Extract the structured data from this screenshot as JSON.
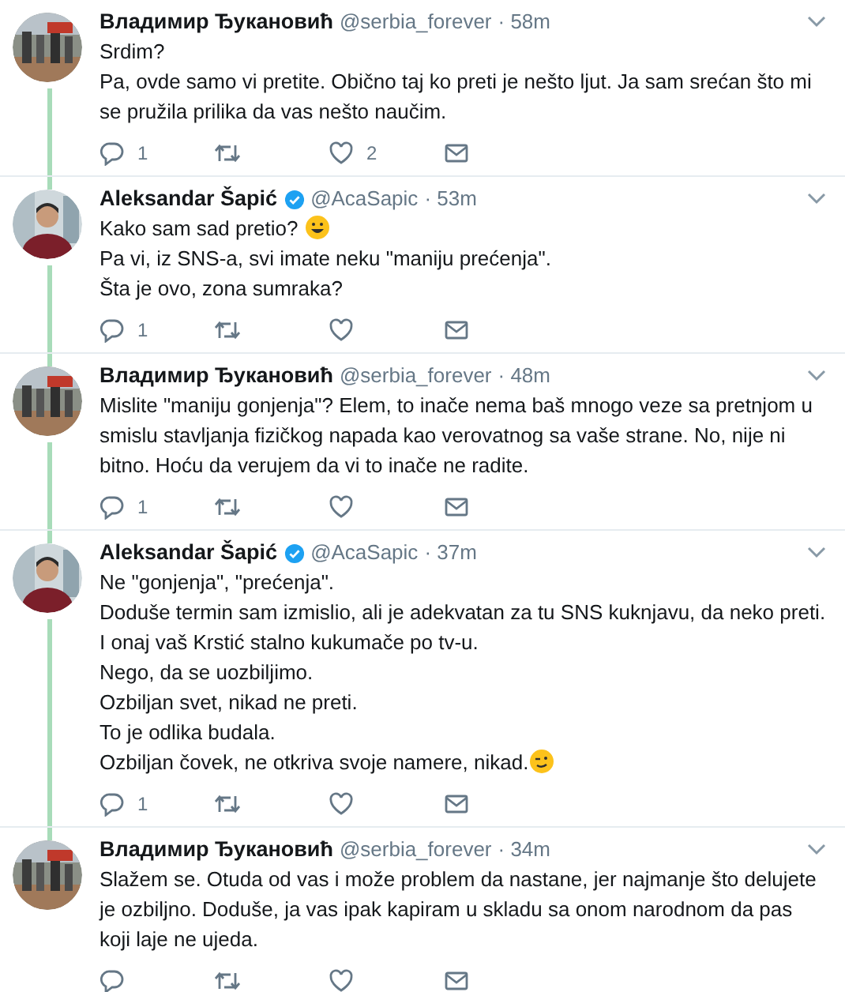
{
  "tweets": [
    {
      "author": "Владимир Ђукановић",
      "verified": false,
      "handle": "@serbia_forever",
      "time": "· 58m",
      "connected_above": false,
      "connected_below": true,
      "paragraphs": [
        {
          "kind": "plain",
          "text": "Srdim?"
        },
        {
          "kind": "plain",
          "text": "Pa, ovde samo vi pretite. Obično taj ko preti je nešto ljut. Ja sam srećan što mi se pružila prilika da vas nešto naučim."
        }
      ],
      "replies": "1",
      "likes": "2"
    },
    {
      "author": "Aleksandar Šapić",
      "verified": true,
      "handle": "@AcaSapic",
      "time": "· 53m",
      "connected_above": true,
      "connected_below": true,
      "paragraphs": [
        {
          "kind": "smiley",
          "text": "Kako sam sad pretio?"
        },
        {
          "kind": "plain",
          "text": "Pa vi, iz SNS-a, svi imate neku \"maniju prećenja\"."
        },
        {
          "kind": "plain",
          "text": "Šta je ovo, zona sumraka?"
        }
      ],
      "replies": "1"
    },
    {
      "author": "Владимир Ђукановић",
      "verified": false,
      "handle": "@serbia_forever",
      "time": "· 48m",
      "connected_above": true,
      "connected_below": true,
      "paragraphs": [
        {
          "kind": "plain",
          "text": "Mislite \"maniju gonjenja\"? Elem, to inače nema baš mnogo veze sa pretnjom  u smislu stavljanja fizičkog napada kao verovatnog sa vaše strane. No, nije ni bitno. Hoću da verujem da vi to inače ne radite."
        }
      ],
      "replies": "1"
    },
    {
      "author": "Aleksandar Šapić",
      "verified": true,
      "handle": "@AcaSapic",
      "time": "· 37m",
      "connected_above": true,
      "connected_below": true,
      "paragraphs": [
        {
          "kind": "plain",
          "text": "Ne \"gonjenja\", \"prećenja\"."
        },
        {
          "kind": "plain",
          "text": "Doduše termin sam izmislio, ali je adekvatan za tu SNS kuknjavu, da neko preti."
        },
        {
          "kind": "plain",
          "text": "I onaj vaš Krstić stalno kukumače po tv-u."
        },
        {
          "kind": "plain",
          "text": "Nego, da se uozbiljimo."
        },
        {
          "kind": "plain",
          "text": "Ozbiljan svet, nikad ne preti."
        },
        {
          "kind": "plain",
          "text": "To je odlika budala."
        },
        {
          "kind": "wink",
          "text": "Ozbiljan čovek, ne otkriva svoje namere, nikad."
        }
      ],
      "replies": "1"
    },
    {
      "author": "Владимир Ђукановић",
      "verified": false,
      "handle": "@serbia_forever",
      "time": "· 34m",
      "connected_above": true,
      "connected_below": false,
      "paragraphs": [
        {
          "kind": "plain",
          "text": "Slažem se. Otuda od vas i može problem da nastane, jer najmanje što delujete je ozbiljno. Doduše, ja vas ipak kapiram u skladu sa onom narodnom da pas koji laje ne ujeda."
        }
      ]
    }
  ]
}
